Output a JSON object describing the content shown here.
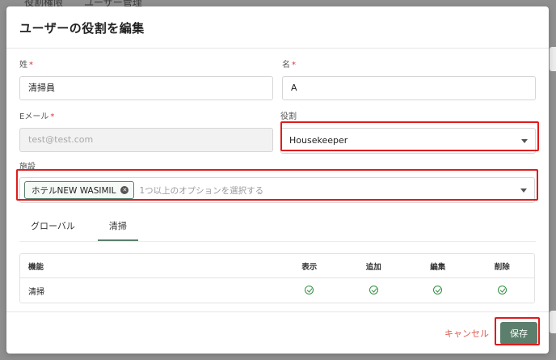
{
  "background": {
    "tabs": [
      "役割権限",
      "ユーザー管理"
    ]
  },
  "modal": {
    "title": "ユーザーの役割を編集",
    "fields": {
      "last_name": {
        "label": "姓",
        "required": "*",
        "value": "清掃員"
      },
      "first_name": {
        "label": "名",
        "required": "*",
        "value": "A"
      },
      "email": {
        "label": "Eメール",
        "required": "*",
        "value": "test@test.com"
      },
      "role": {
        "label": "役割",
        "value": "Housekeeper"
      },
      "facility": {
        "label": "施設",
        "chip": "ホテルNEW WASIMIL",
        "placeholder": "1つ以上のオプションを選択する"
      }
    },
    "tabs": [
      {
        "label": "グローバル"
      },
      {
        "label": "清掃"
      }
    ],
    "table": {
      "headers": [
        "機能",
        "表示",
        "追加",
        "編集",
        "削除"
      ],
      "rows": [
        {
          "feature": "清掃"
        }
      ]
    },
    "footer": {
      "cancel_label": "キャンセル",
      "save_label": "保存"
    }
  },
  "colors": {
    "accent": "#5b7f6c",
    "highlight": "#e01b1b",
    "check": "#2f8f3f",
    "cancel": "#d8584a"
  }
}
